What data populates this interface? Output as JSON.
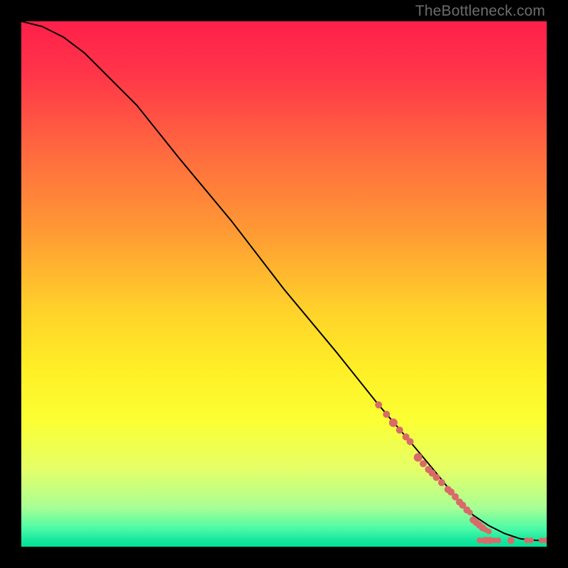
{
  "watermark": "TheBottleneck.com",
  "chart_data": {
    "type": "line",
    "title": "",
    "xlabel": "",
    "ylabel": "",
    "xlim": [
      0,
      100
    ],
    "ylim": [
      0,
      100
    ],
    "background_gradient_stops": [
      {
        "offset": 0.0,
        "color": "#ff1f4b"
      },
      {
        "offset": 0.1,
        "color": "#ff3549"
      },
      {
        "offset": 0.25,
        "color": "#ff6a3f"
      },
      {
        "offset": 0.4,
        "color": "#ff9a34"
      },
      {
        "offset": 0.55,
        "color": "#ffd22a"
      },
      {
        "offset": 0.66,
        "color": "#ffee26"
      },
      {
        "offset": 0.76,
        "color": "#fbff33"
      },
      {
        "offset": 0.85,
        "color": "#e6ff66"
      },
      {
        "offset": 0.925,
        "color": "#a9ff94"
      },
      {
        "offset": 0.965,
        "color": "#4dfba6"
      },
      {
        "offset": 0.985,
        "color": "#1de9a0"
      },
      {
        "offset": 1.0,
        "color": "#00e095"
      }
    ],
    "series": [
      {
        "name": "curve",
        "x": [
          0,
          4,
          8,
          12,
          16,
          22,
          30,
          40,
          50,
          60,
          68,
          74,
          79,
          83,
          86,
          89,
          92,
          95,
          98,
          100
        ],
        "y": [
          100,
          99,
          97,
          94,
          90,
          84,
          74,
          62,
          49,
          37,
          27,
          20,
          14,
          9,
          6,
          4,
          2.5,
          1.5,
          1.2,
          1.2
        ]
      }
    ],
    "marker_series": {
      "name": "points",
      "color": "#d96a6a",
      "points": [
        {
          "x": 68.0,
          "y": 27.0,
          "r": 5
        },
        {
          "x": 69.5,
          "y": 25.2,
          "r": 5
        },
        {
          "x": 70.8,
          "y": 23.6,
          "r": 6
        },
        {
          "x": 72.0,
          "y": 22.2,
          "r": 5
        },
        {
          "x": 73.2,
          "y": 20.9,
          "r": 5
        },
        {
          "x": 74.0,
          "y": 20.0,
          "r": 5
        },
        {
          "x": 75.5,
          "y": 17.0,
          "r": 6
        },
        {
          "x": 76.5,
          "y": 15.8,
          "r": 5
        },
        {
          "x": 77.5,
          "y": 14.7,
          "r": 5
        },
        {
          "x": 78.2,
          "y": 14.0,
          "r": 5
        },
        {
          "x": 79.0,
          "y": 13.2,
          "r": 5
        },
        {
          "x": 80.0,
          "y": 12.2,
          "r": 5
        },
        {
          "x": 81.2,
          "y": 10.9,
          "r": 5
        },
        {
          "x": 81.8,
          "y": 10.4,
          "r": 5
        },
        {
          "x": 82.6,
          "y": 9.5,
          "r": 5
        },
        {
          "x": 83.4,
          "y": 8.5,
          "r": 5
        },
        {
          "x": 84.0,
          "y": 7.9,
          "r": 5
        },
        {
          "x": 84.8,
          "y": 7.0,
          "r": 5
        },
        {
          "x": 85.4,
          "y": 6.5,
          "r": 4
        },
        {
          "x": 86.0,
          "y": 5.1,
          "r": 5
        },
        {
          "x": 86.6,
          "y": 4.6,
          "r": 5
        },
        {
          "x": 87.2,
          "y": 4.1,
          "r": 5
        },
        {
          "x": 87.8,
          "y": 3.6,
          "r": 5
        },
        {
          "x": 88.4,
          "y": 3.2,
          "r": 4
        },
        {
          "x": 89.0,
          "y": 2.9,
          "r": 4
        },
        {
          "x": 87.2,
          "y": 1.2,
          "r": 4
        },
        {
          "x": 87.8,
          "y": 1.2,
          "r": 4
        },
        {
          "x": 88.4,
          "y": 1.2,
          "r": 5
        },
        {
          "x": 89.2,
          "y": 1.2,
          "r": 5
        },
        {
          "x": 90.0,
          "y": 1.2,
          "r": 4
        },
        {
          "x": 90.8,
          "y": 1.2,
          "r": 4
        },
        {
          "x": 93.2,
          "y": 1.2,
          "r": 5
        },
        {
          "x": 96.2,
          "y": 1.2,
          "r": 4
        },
        {
          "x": 97.0,
          "y": 1.2,
          "r": 4
        },
        {
          "x": 99.0,
          "y": 1.2,
          "r": 4
        },
        {
          "x": 99.8,
          "y": 1.2,
          "r": 4
        }
      ]
    }
  }
}
